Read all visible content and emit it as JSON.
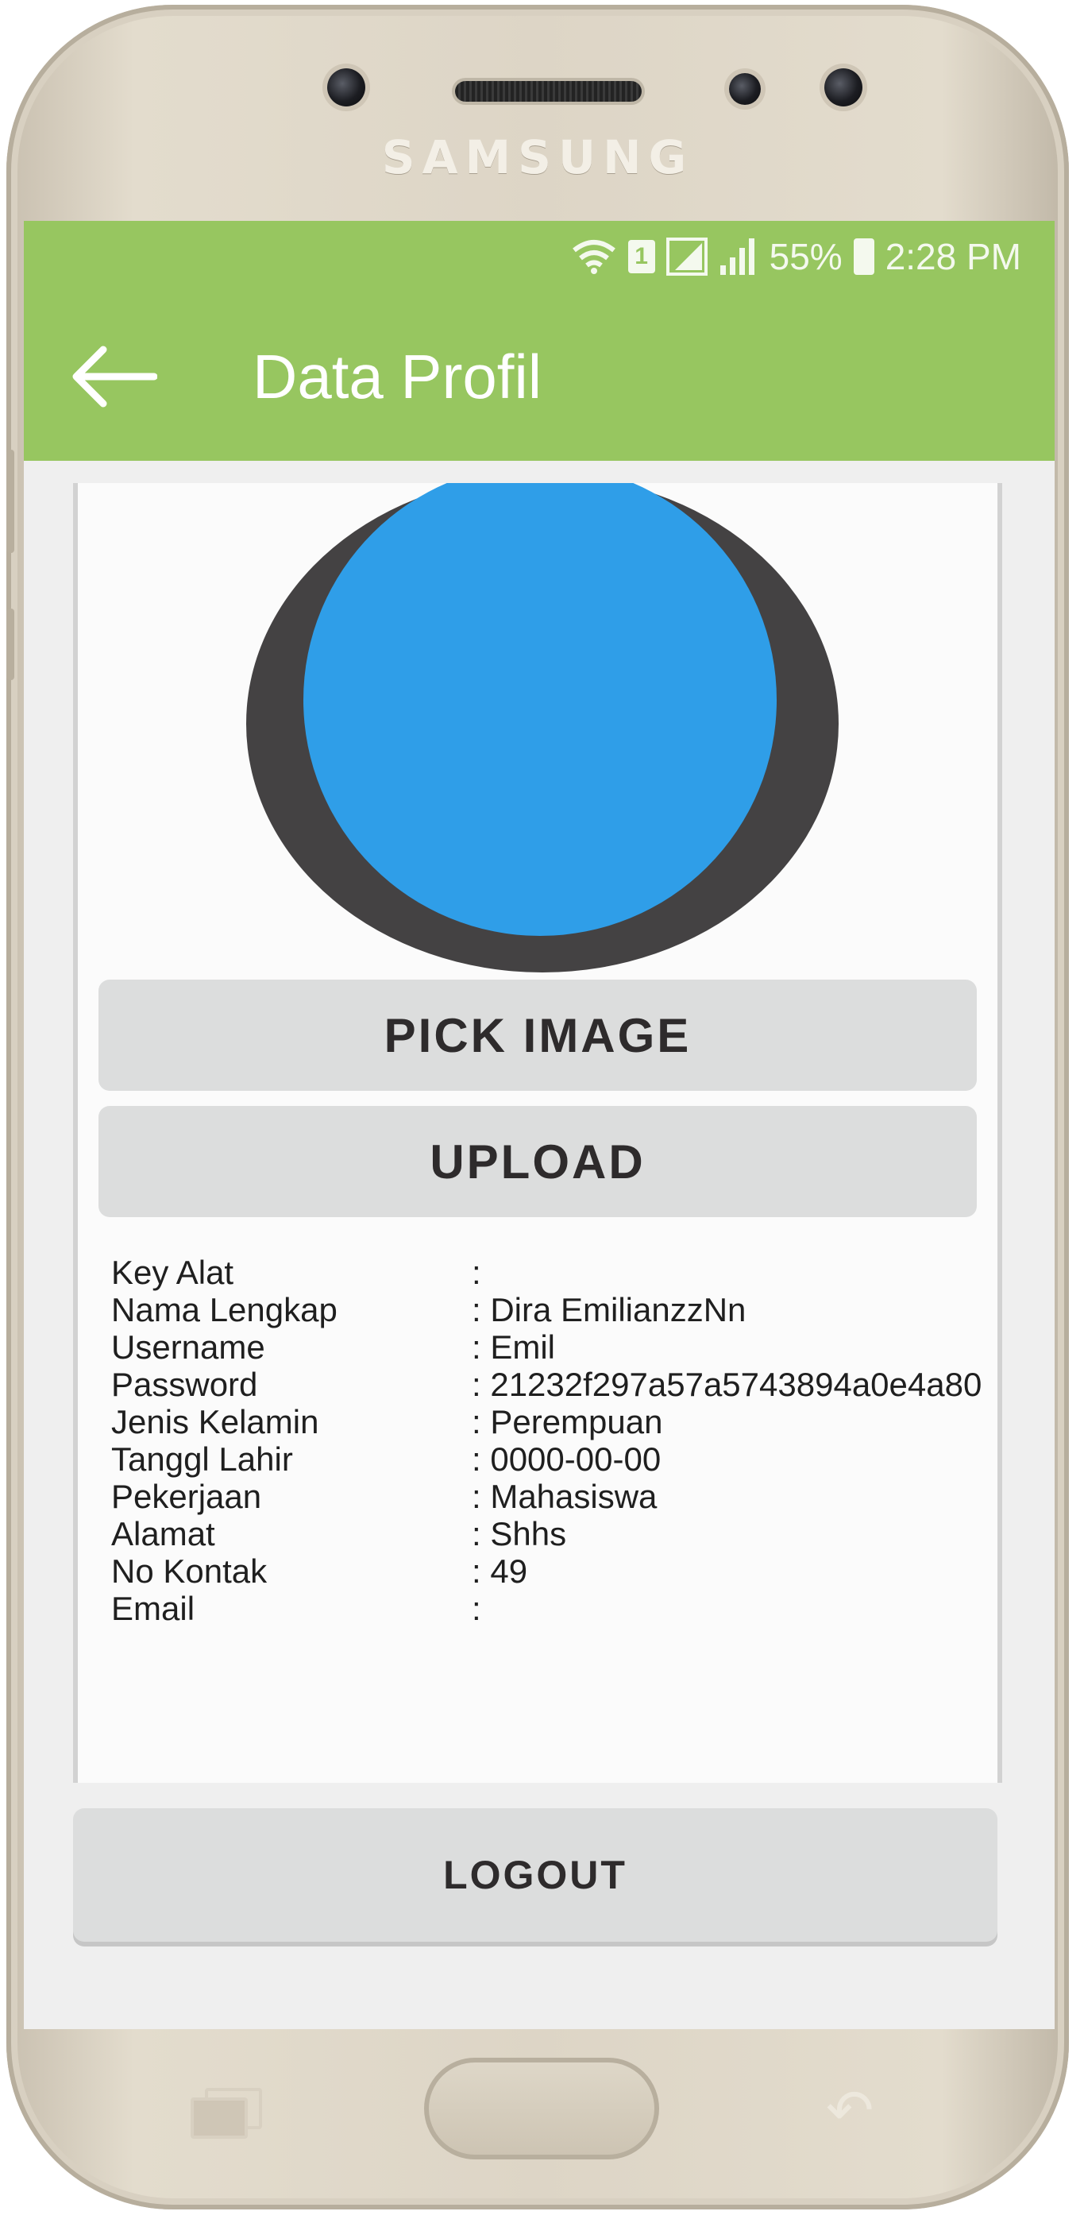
{
  "device": {
    "brand": "SAMSUNG"
  },
  "status_bar": {
    "battery": "55%",
    "time": "2:28 PM",
    "sim_slot": "1",
    "icons": [
      "wifi-icon",
      "sim-icon",
      "signal-icon",
      "signal-bars-icon",
      "battery-icon"
    ]
  },
  "app_bar": {
    "title": "Data Profil",
    "back_icon": "arrow-left-icon",
    "color": "#97c660"
  },
  "avatar": {
    "ring_color": "#444243",
    "fill_color": "#2f9ee8"
  },
  "buttons": {
    "pick_image": "PICK IMAGE",
    "upload": "UPLOAD",
    "logout": "LOGOUT"
  },
  "profile": [
    {
      "label": "Key Alat",
      "value": ":"
    },
    {
      "label": "Nama Lengkap",
      "value": ": Dira EmilianzzNn"
    },
    {
      "label": "Username",
      "value": ": Emil"
    },
    {
      "label": "Password",
      "value": ": 21232f297a57a5743894a0e4a80"
    },
    {
      "label": "Jenis Kelamin",
      "value": ": Perempuan"
    },
    {
      "label": "Tanggl Lahir",
      "value": ": 0000-00-00"
    },
    {
      "label": "Pekerjaan",
      "value": ": Mahasiswa"
    },
    {
      "label": "Alamat",
      "value": ": Shhs"
    },
    {
      "label": "No Kontak",
      "value": ": 49"
    },
    {
      "label": "Email",
      "value": ":"
    }
  ],
  "nav_keys": [
    "recent-apps-icon",
    "home-button",
    "back-key-icon"
  ]
}
